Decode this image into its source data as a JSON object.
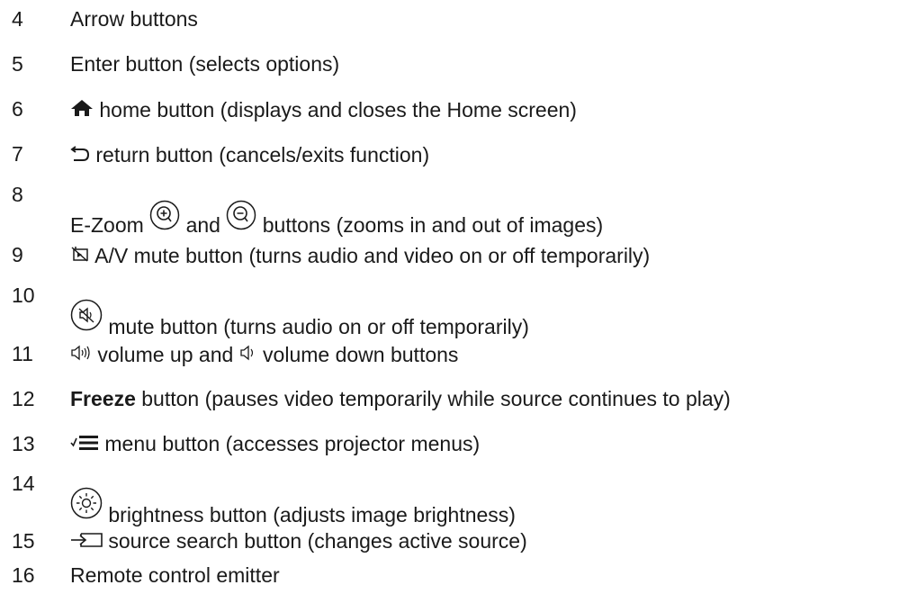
{
  "items": [
    {
      "num": "4",
      "text": "Arrow buttons"
    },
    {
      "num": "5",
      "text": "Enter button (selects options)"
    },
    {
      "num": "6",
      "icon": "home-icon",
      "text": " home button (displays and closes the Home screen)"
    },
    {
      "num": "7",
      "icon": "return-arrow-icon",
      "text": " return button (cancels/exits function)"
    },
    {
      "num": "8",
      "pre": "E-Zoom ",
      "mid": " and ",
      "post": " buttons (zooms in and out of images)",
      "icons": [
        "zoom-in-icon",
        "zoom-out-icon"
      ]
    },
    {
      "num": "9",
      "icon": "av-mute-icon",
      "text": " A/V mute button (turns audio and video on or off temporarily)"
    },
    {
      "num": "10",
      "icon": "mute-icon",
      "text": " mute button (turns audio on or off temporarily)"
    },
    {
      "num": "11",
      "mid": " volume up and ",
      "post": " volume down buttons",
      "icons": [
        "volume-up-icon",
        "volume-down-icon"
      ]
    },
    {
      "num": "12",
      "bold": "Freeze",
      "text": " button (pauses video temporarily while source continues to play)"
    },
    {
      "num": "13",
      "icon": "menu-icon",
      "text": " menu button (accesses projector menus)"
    },
    {
      "num": "14",
      "icon": "brightness-icon",
      "text": " brightness button (adjusts image brightness)"
    },
    {
      "num": "15",
      "icon": "source-search-icon",
      "text": " source search button (changes active source)"
    },
    {
      "num": "16",
      "text": "Remote control emitter"
    }
  ]
}
